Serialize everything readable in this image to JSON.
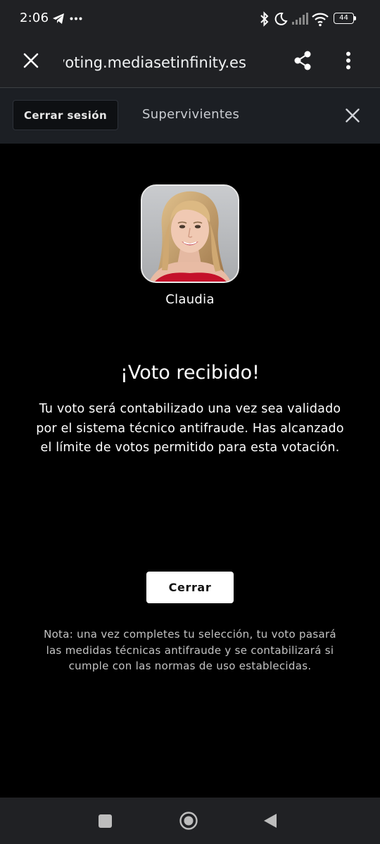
{
  "status_bar": {
    "time": "2:06",
    "battery": "44",
    "icons": [
      "telegram-icon",
      "more-notifications-icon",
      "bluetooth-icon",
      "moon-icon",
      "signal-icon",
      "wifi-icon",
      "battery-icon"
    ]
  },
  "browser": {
    "url": "voting.mediasetinfinity.es",
    "icons": [
      "close-icon",
      "share-icon",
      "more-vert-icon"
    ]
  },
  "header": {
    "logout_label": "Cerrar sesión",
    "section_title": "Supervivientes"
  },
  "candidate": {
    "name": "Claudia"
  },
  "result": {
    "title": "¡Voto recibido!",
    "message": "Tu voto será contabilizado una vez sea validado por el sistema técnico antifraude. Has alcanzado el límite de votos permitido para esta votación.",
    "close_label": "Cerrar",
    "note": "Nota: una vez completes tu selección, tu voto pasará las medidas técnicas antifraude y se contabilizará si cumple con las normas de uso establecidas."
  },
  "colors": {
    "background": "#000000",
    "chrome_bar": "#202124",
    "header_bar": "#1c1f24",
    "button_bg": "#ffffff"
  },
  "nav": {
    "icons": [
      "recents-icon",
      "home-icon",
      "back-icon"
    ]
  }
}
